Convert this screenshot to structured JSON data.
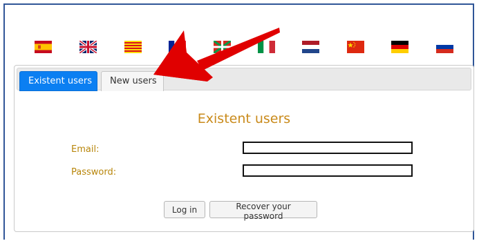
{
  "flags": [
    {
      "name": "spain-flag-icon"
    },
    {
      "name": "uk-flag-icon"
    },
    {
      "name": "catalonia-flag-icon"
    },
    {
      "name": "france-flag-icon"
    },
    {
      "name": "basque-flag-icon"
    },
    {
      "name": "italy-flag-icon"
    },
    {
      "name": "netherlands-flag-icon"
    },
    {
      "name": "china-flag-icon"
    },
    {
      "name": "germany-flag-icon"
    },
    {
      "name": "russia-flag-icon"
    }
  ],
  "tabs": {
    "existent_label": "Existent users",
    "new_label": "New users"
  },
  "login": {
    "title": "Existent users",
    "email_label": "Email:",
    "password_label": "Password:",
    "email_value": "",
    "password_value": "",
    "login_button": "Log in",
    "recover_button": "Recover your password"
  },
  "colors": {
    "tab_active": "#0b7ff2",
    "accent_text": "#c98a1a",
    "annotation_arrow": "#e00000"
  },
  "annotation": {
    "type": "arrow",
    "points_to": "new-users-tab"
  }
}
